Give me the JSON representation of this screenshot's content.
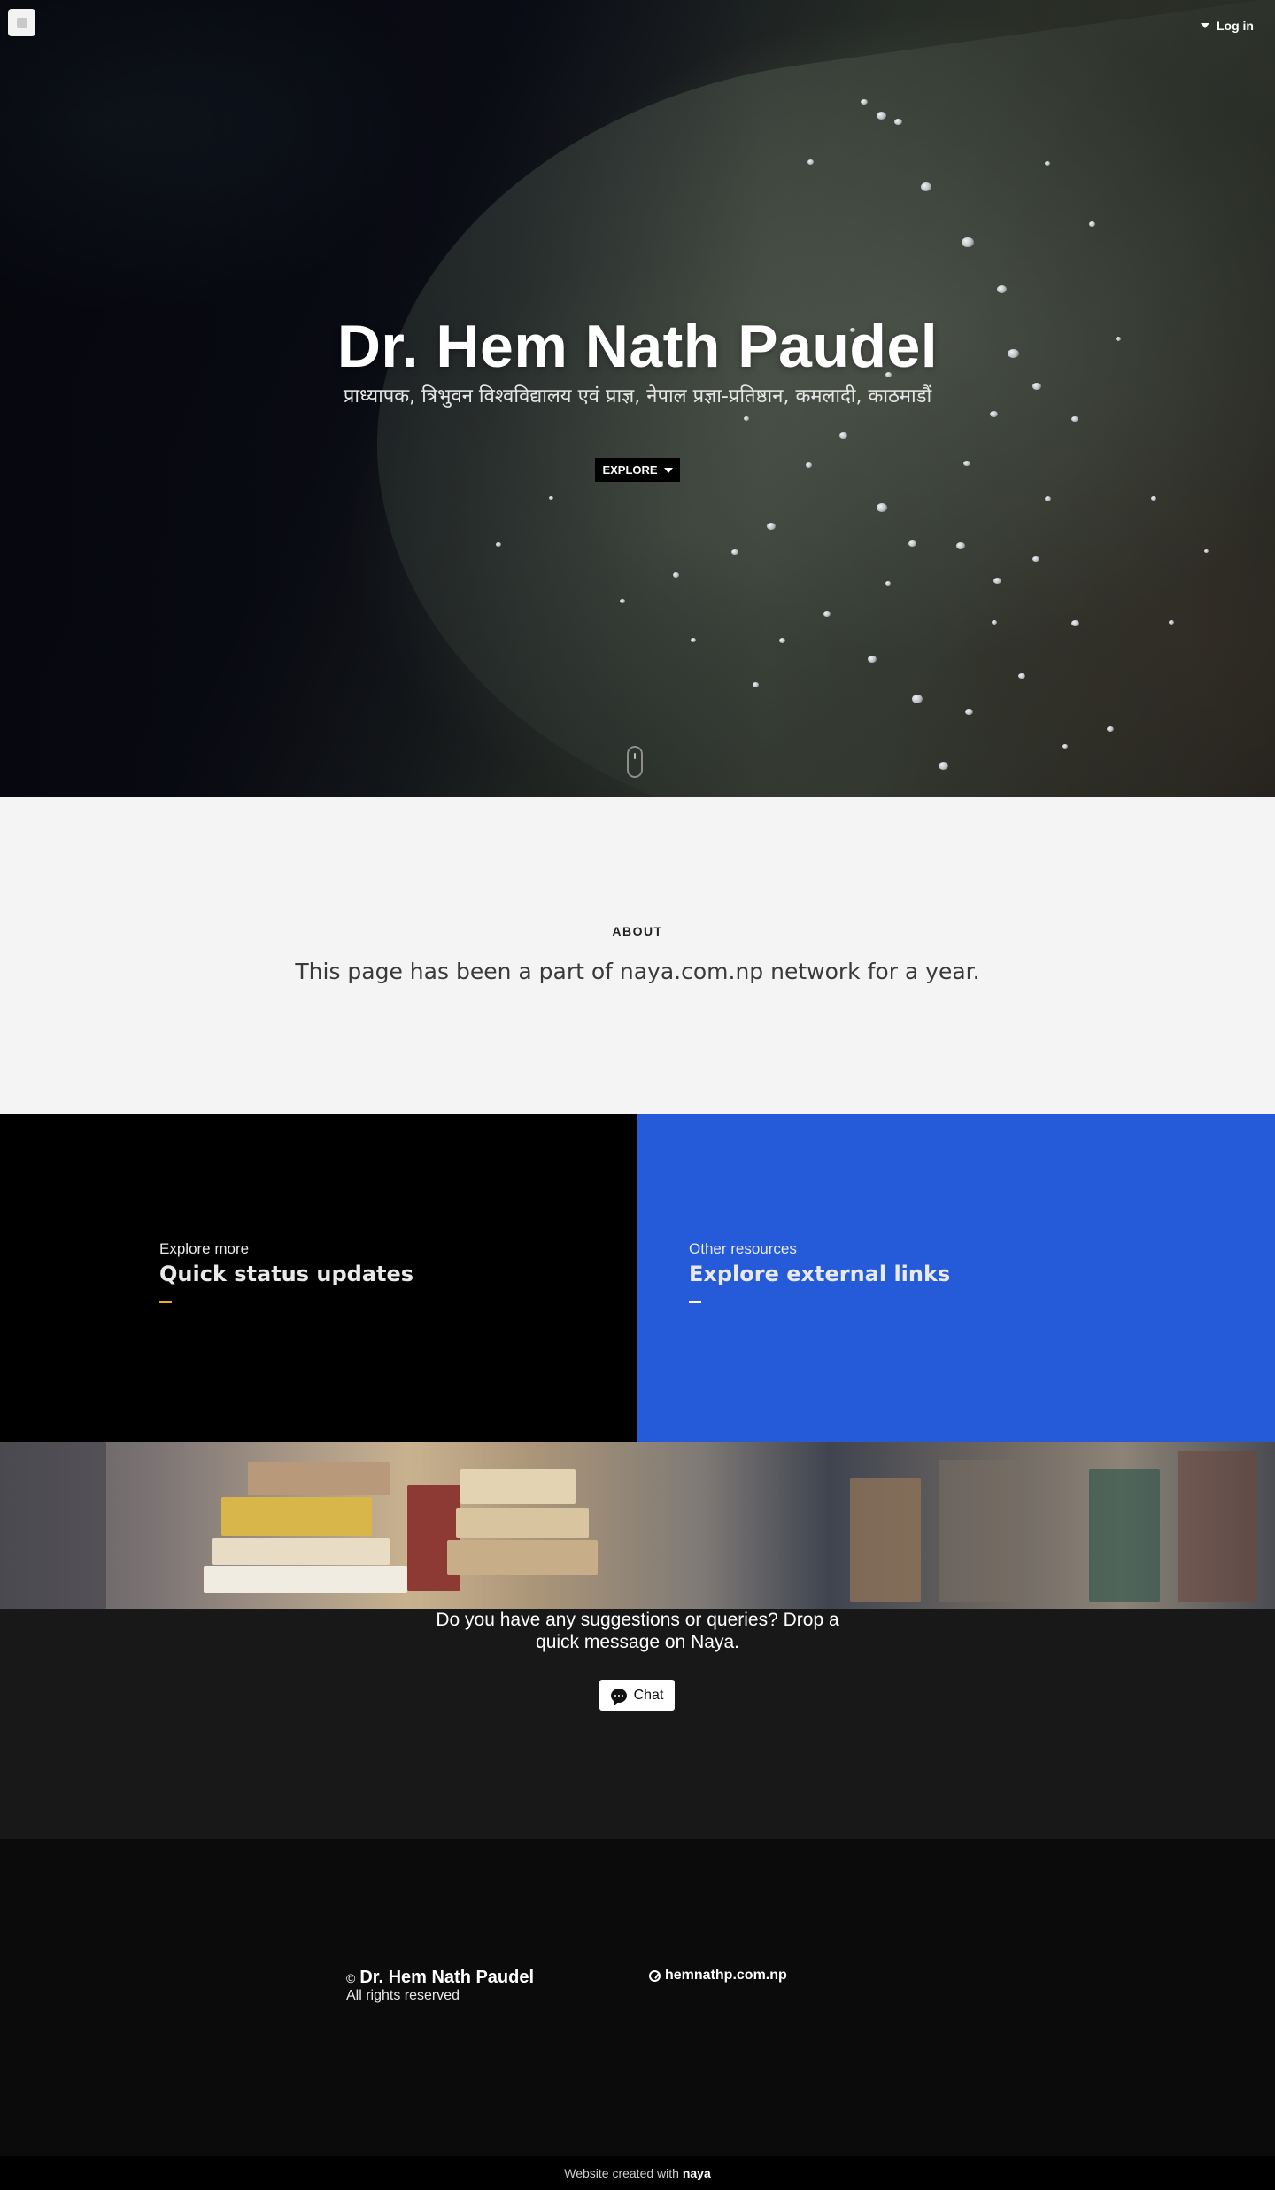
{
  "header": {
    "login_label": "Log in"
  },
  "hero": {
    "title": "Dr. Hem Nath Paudel",
    "subtitle": "प्राध्यापक, त्रिभुवन विश्वविद्यालय एवं प्राज्ञ, नेपाल प्रज्ञा-प्रतिष्ठान, कमलादी, काठमाडौं",
    "explore_label": "EXPLORE"
  },
  "about": {
    "label": "ABOUT",
    "text": "This page has been a part of naya.com.np network for a year."
  },
  "tiles": [
    {
      "kicker": "Explore more",
      "heading": "Quick status updates",
      "accent": "#f0a92a",
      "background": "#000000"
    },
    {
      "kicker": "Other resources",
      "heading": "Explore external links",
      "accent": "#ffffff",
      "background": "#255bd8"
    }
  ],
  "contact": {
    "text": "Do you have any suggestions or queries? Drop a quick message on Naya.",
    "chat_label": "Chat"
  },
  "footer": {
    "copyright_symbol": "©",
    "name": "Dr. Hem Nath Paudel",
    "rights": "All rights reserved",
    "site_link": "hemnathp.com.np"
  },
  "credit": {
    "prefix": "Website created with",
    "brand": "naya"
  }
}
